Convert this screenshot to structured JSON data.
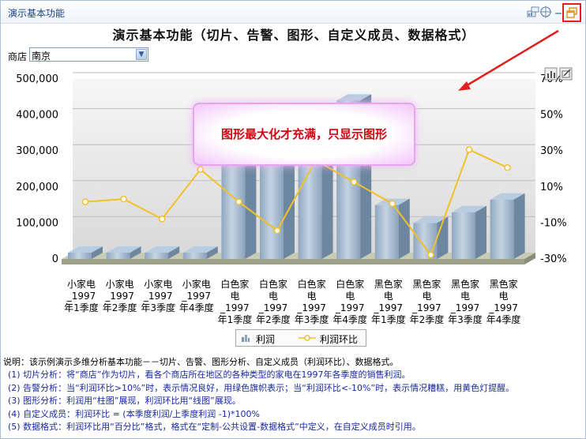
{
  "window": {
    "title": "演示基本功能"
  },
  "icons": {
    "chart_switch": "chart-switch-icon",
    "target": "target-icon",
    "minimize": "minimize-icon",
    "restore": "restore-window-icon",
    "chart_toolbar_1": "chart-view-icon",
    "chart_toolbar_2": "chart-edit-icon"
  },
  "main_title": "演示基本功能（切片、告警、图形、自定义成员、数据格式）",
  "store": {
    "label": "商店",
    "value": "南京"
  },
  "tooltip": {
    "text": "图形最大化才充满，只显示图形"
  },
  "colors": {
    "bar": "#8ea7c0",
    "line": "#f2c028",
    "highlight": "#e02020",
    "tooltip_text": "#d80010"
  },
  "chart_data": {
    "type": "bar",
    "categories": [
      [
        "小家电",
        "_1997",
        "年1季度"
      ],
      [
        "小家电",
        "_1997",
        "年2季度"
      ],
      [
        "小家电",
        "_1997",
        "年3季度"
      ],
      [
        "小家电",
        "_1997",
        "年4季度"
      ],
      [
        "白色家",
        "电",
        "_1997",
        "年1季度"
      ],
      [
        "白色家",
        "电",
        "_1997",
        "年2季度"
      ],
      [
        "白色家",
        "电",
        "_1997",
        "年3季度"
      ],
      [
        "白色家",
        "电",
        "_1997",
        "年4季度"
      ],
      [
        "黑色家",
        "电",
        "_1997",
        "年1季度"
      ],
      [
        "黑色家",
        "电",
        "_1997",
        "年2季度"
      ],
      [
        "黑色家",
        "电",
        "_1997",
        "年3季度"
      ],
      [
        "黑色家",
        "电",
        "_1997",
        "年4季度"
      ]
    ],
    "y_ticks": [
      "500,000",
      "400,000",
      "300,000",
      "200,000",
      "100,000",
      "0"
    ],
    "y2_ticks": [
      "70%",
      "50%",
      "30%",
      "10%",
      "-10%",
      "-30%"
    ],
    "ylim": [
      0,
      500000
    ],
    "y2lim": [
      -30,
      70
    ],
    "grid": true,
    "legend_position": "bottom",
    "series": [
      {
        "name": "利润",
        "type": "bar",
        "values": [
          5000,
          5000,
          4000,
          8000,
          310000,
          290000,
          380000,
          440000,
          150000,
          100000,
          130000,
          165000
        ]
      },
      {
        "name": "利润环比",
        "type": "line",
        "values": [
          0,
          1.5,
          -9.5,
          18,
          0,
          -16,
          23,
          11,
          -1,
          -29.5,
          29,
          19
        ]
      }
    ]
  },
  "description": {
    "lines": [
      "说明：该示例演示多维分析基本功能－－切片、告警、图形分析、自定义成员（利润环比）、数据格式。",
      "(1) 切片分析：将“商店”作为切片，看各个商店所在地区的各种类型的家电在1997年各季度的销售利润。",
      "(2) 告警分析：当“利润环比>10%”时，表示情况良好，用绿色旗帜表示；当“利润环比<-10%”时，表示情况糟糕，用黄色灯提醒。",
      "(3) 图形分析：利润用“柱图”展现，利润环比用“线图”展现。",
      "(4) 自定义成员：利润环比  = (本季度利润/上季度利润  -1)*100%",
      "(5) 数据格式：利润环比用“百分比”格式，格式在“定制-公共设置-数据格式”中定义，在自定义成员时引用。"
    ]
  }
}
